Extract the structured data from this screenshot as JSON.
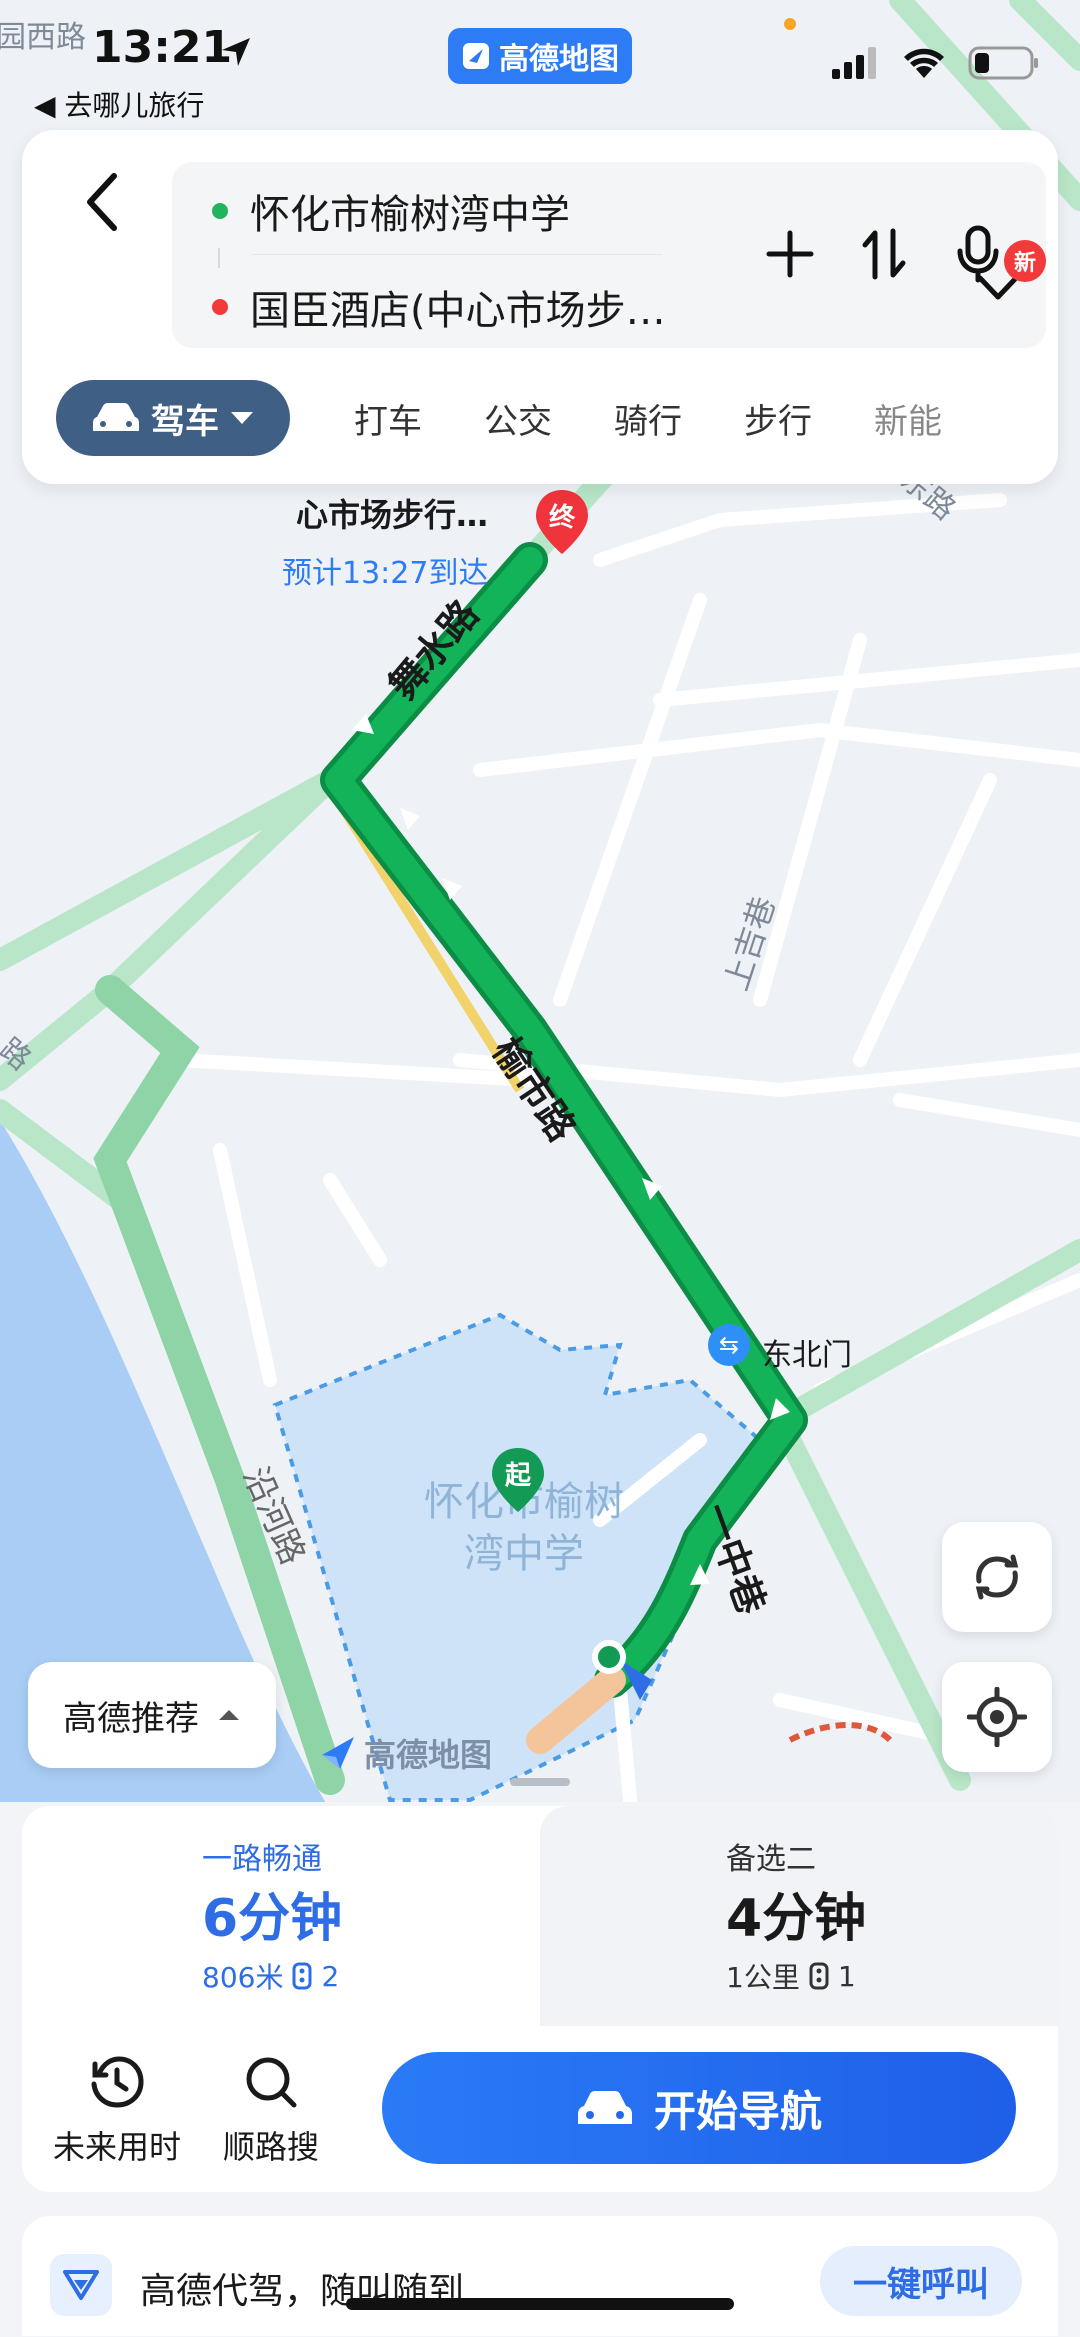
{
  "status": {
    "time": "13:21",
    "back_app": "◀ 去哪儿旅行",
    "app_pill": "高德地图"
  },
  "search": {
    "origin": "怀化市榆树湾中学",
    "destination": "国臣酒店(中心市场步…",
    "origin_color": "#22b35e",
    "destination_color": "#f23a3a"
  },
  "modes": {
    "active": "驾车",
    "tabs": [
      "打车",
      "公交",
      "骑行",
      "步行",
      "新能"
    ],
    "new_badge": "新"
  },
  "map": {
    "top_left_label": "园西路",
    "right_top_label": "东路",
    "left_label": "路",
    "road_1": "舞水路",
    "road_2": "榆市路",
    "road_3": "一中巷",
    "road_4": "沿河路",
    "alley": "上吉巷",
    "dest_name": "心市场步行…",
    "dest_eta": "预计13:27到达",
    "end_marker": "终",
    "start_marker": "起",
    "gate_label": "东北门",
    "school_name": "怀化市榆树湾中学",
    "brand": "高德地图",
    "route_color": "#13b35a"
  },
  "recommend": {
    "label": "高德推荐"
  },
  "routes": [
    {
      "tag": "一路畅通",
      "time": "6分钟",
      "distance": "806米",
      "lights": "2"
    },
    {
      "tag": "备选二",
      "time": "4分钟",
      "distance": "1公里",
      "lights": "1"
    }
  ],
  "utils": {
    "future": "未来用时",
    "search_along": "顺路搜"
  },
  "nav_button": "开始导航",
  "promo": {
    "text": "高德代驾，随叫随到",
    "button": "一键呼叫"
  }
}
